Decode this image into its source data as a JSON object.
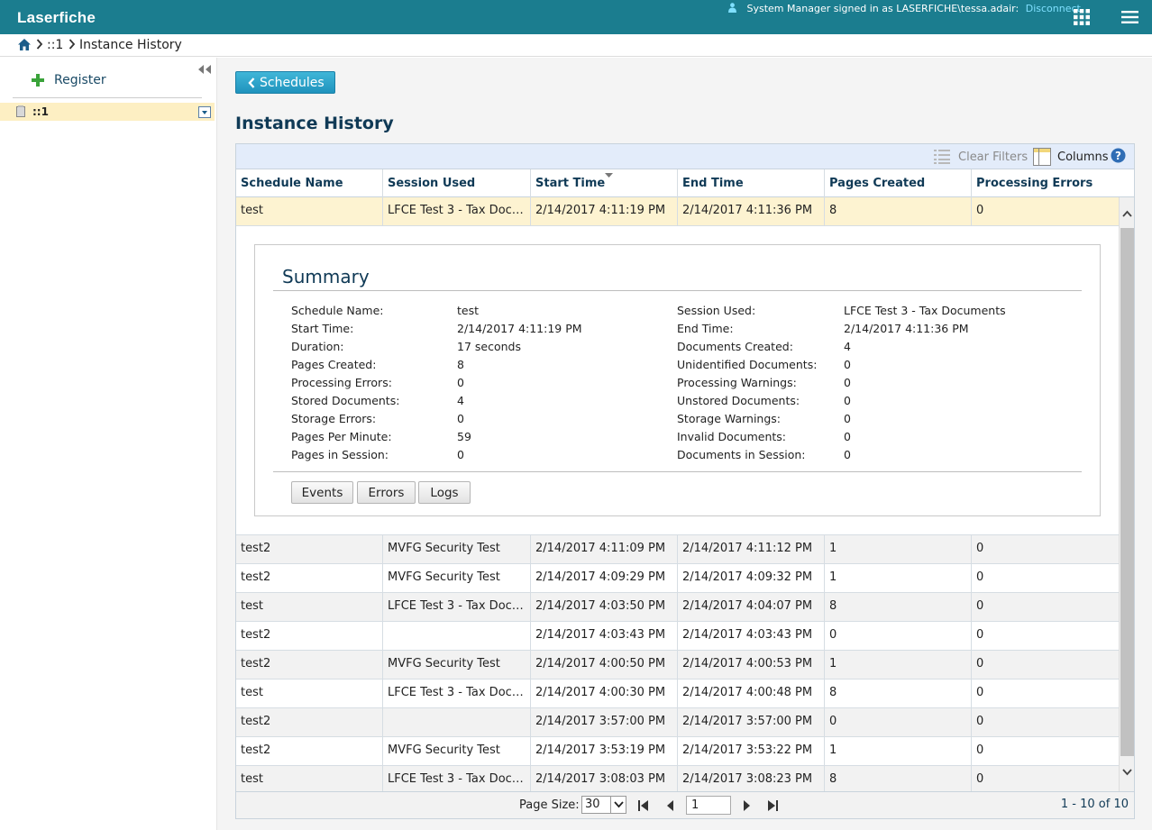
{
  "app": {
    "logo": "Laserfiche",
    "user_text": "System Manager signed in as LASERFICHE\\tessa.adair:",
    "disconnect": "Disconnect"
  },
  "breadcrumb": {
    "items": [
      "::1",
      "Instance History"
    ]
  },
  "sidebar": {
    "register": "Register",
    "tree_item": "::1"
  },
  "main": {
    "back_button": "Schedules",
    "title": "Instance History",
    "toolbar": {
      "clear_filters": "Clear Filters",
      "columns": "Columns"
    },
    "columns": [
      "Schedule Name",
      "Session Used",
      "Start Time",
      "End Time",
      "Pages Created",
      "Processing Errors"
    ],
    "selected_row": [
      "test",
      "LFCE Test 3 - Tax Docu...",
      "2/14/2017 4:11:19 PM",
      "2/14/2017 4:11:36 PM",
      "8",
      "0"
    ],
    "rows": [
      [
        "test2",
        "MVFG Security Test",
        "2/14/2017 4:11:09 PM",
        "2/14/2017 4:11:12 PM",
        "1",
        "0"
      ],
      [
        "test2",
        "MVFG Security Test",
        "2/14/2017 4:09:29 PM",
        "2/14/2017 4:09:32 PM",
        "1",
        "0"
      ],
      [
        "test",
        "LFCE Test 3 - Tax Docu...",
        "2/14/2017 4:03:50 PM",
        "2/14/2017 4:04:07 PM",
        "8",
        "0"
      ],
      [
        "test2",
        "",
        "2/14/2017 4:03:43 PM",
        "2/14/2017 4:03:43 PM",
        "0",
        "0"
      ],
      [
        "test2",
        "MVFG Security Test",
        "2/14/2017 4:00:50 PM",
        "2/14/2017 4:00:53 PM",
        "1",
        "0"
      ],
      [
        "test",
        "LFCE Test 3 - Tax Docu...",
        "2/14/2017 4:00:30 PM",
        "2/14/2017 4:00:48 PM",
        "8",
        "0"
      ],
      [
        "test2",
        "",
        "2/14/2017 3:57:00 PM",
        "2/14/2017 3:57:00 PM",
        "0",
        "0"
      ],
      [
        "test2",
        "MVFG Security Test",
        "2/14/2017 3:53:19 PM",
        "2/14/2017 3:53:22 PM",
        "1",
        "0"
      ],
      [
        "test",
        "LFCE Test 3 - Tax Docu...",
        "2/14/2017 3:08:03 PM",
        "2/14/2017 3:08:23 PM",
        "8",
        "0"
      ]
    ],
    "summary": {
      "title": "Summary",
      "left": [
        [
          "Schedule Name:",
          "test"
        ],
        [
          "Start Time:",
          "2/14/2017 4:11:19 PM"
        ],
        [
          "Duration:",
          "17 seconds"
        ],
        [
          "Pages Created:",
          "8"
        ],
        [
          "Processing Errors:",
          "0"
        ],
        [
          "Stored Documents:",
          "4"
        ],
        [
          "Storage Errors:",
          "0"
        ],
        [
          "Pages Per Minute:",
          "59"
        ],
        [
          "Pages in Session:",
          "0"
        ]
      ],
      "right": [
        [
          "Session Used:",
          "LFCE Test 3 - Tax Documents"
        ],
        [
          "End Time:",
          "2/14/2017 4:11:36 PM"
        ],
        [
          "Documents Created:",
          "4"
        ],
        [
          "Unidentified Documents:",
          "0"
        ],
        [
          "Processing Warnings:",
          "0"
        ],
        [
          "Unstored Documents:",
          "0"
        ],
        [
          "Storage Warnings:",
          "0"
        ],
        [
          "Invalid Documents:",
          "0"
        ],
        [
          "Documents in Session:",
          "0"
        ]
      ],
      "buttons": [
        "Events",
        "Errors",
        "Logs"
      ]
    },
    "pager": {
      "page_size_label": "Page Size:",
      "page_size": "30",
      "page": "1",
      "range": "1 - 10 of 10"
    }
  },
  "colors": {
    "topbar": "#1b7d8f",
    "accent": "#2aa0c9",
    "title": "#103a56",
    "selected_row": "#fdf3d1"
  }
}
